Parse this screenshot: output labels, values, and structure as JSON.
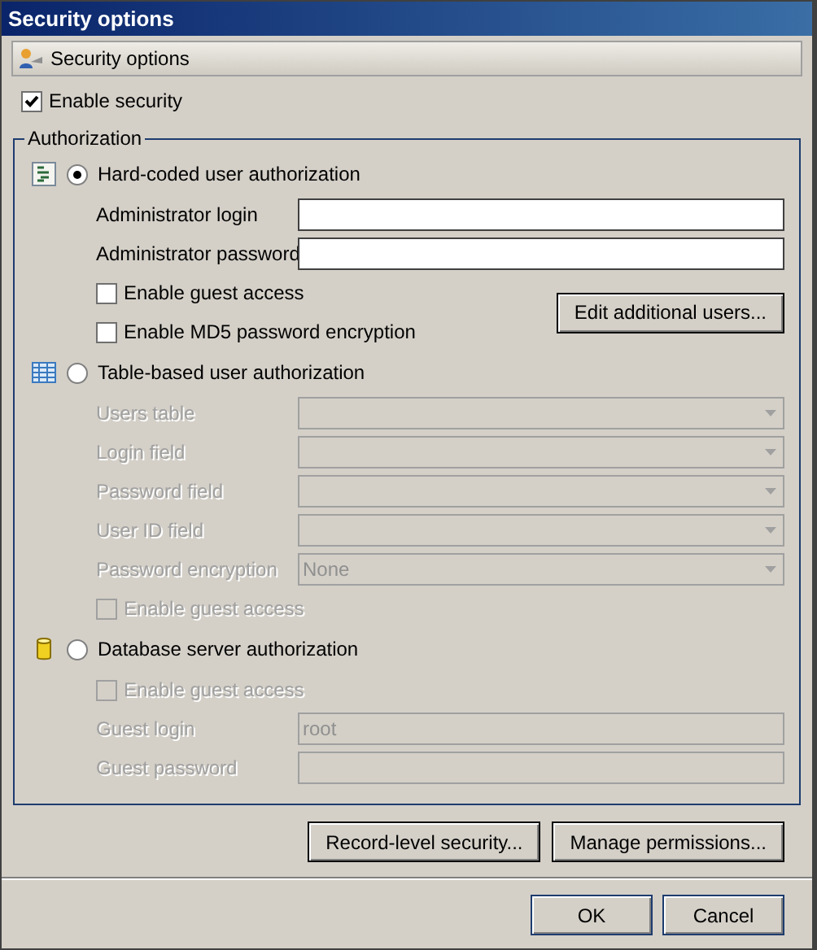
{
  "window": {
    "title": "Security options"
  },
  "header": {
    "title": "Security options"
  },
  "enable_security": {
    "label": "Enable security",
    "checked": true
  },
  "authorization": {
    "title": "Authorization",
    "modes": [
      {
        "kind": "hardcoded",
        "label": "Hard-coded user authorization",
        "selected": true,
        "disabled": false,
        "rows": [
          {
            "kind": "text",
            "label": "Administrator login"
          },
          {
            "kind": "text",
            "label": "Administrator password"
          }
        ],
        "options": [
          {
            "label": "Enable guest access",
            "checked": false
          },
          {
            "label": "Enable MD5 password encryption",
            "checked": false
          }
        ],
        "button": "Edit additional users..."
      },
      {
        "kind": "table",
        "label": "Table-based user authorization",
        "selected": false,
        "disabled": true,
        "rows": [
          {
            "kind": "select",
            "label": "Users table"
          },
          {
            "kind": "select",
            "label": "Login field"
          },
          {
            "kind": "select",
            "label": "Password field"
          },
          {
            "kind": "select",
            "label": "User ID field"
          },
          {
            "kind": "select",
            "label": "Password encryption",
            "value": "None"
          }
        ],
        "options": [
          {
            "label": "Enable guest access",
            "checked": false
          }
        ]
      },
      {
        "kind": "database",
        "label": "Database server authorization",
        "selected": false,
        "disabled": true,
        "options": [
          {
            "label": "Enable guest access",
            "checked": false
          }
        ],
        "rows": [
          {
            "kind": "text",
            "label": "Guest login",
            "value": "root"
          },
          {
            "kind": "text",
            "label": "Guest password"
          }
        ]
      }
    ]
  },
  "actions": [
    "Record-level security...",
    "Manage permissions..."
  ],
  "buttons": [
    "OK",
    "Cancel"
  ]
}
